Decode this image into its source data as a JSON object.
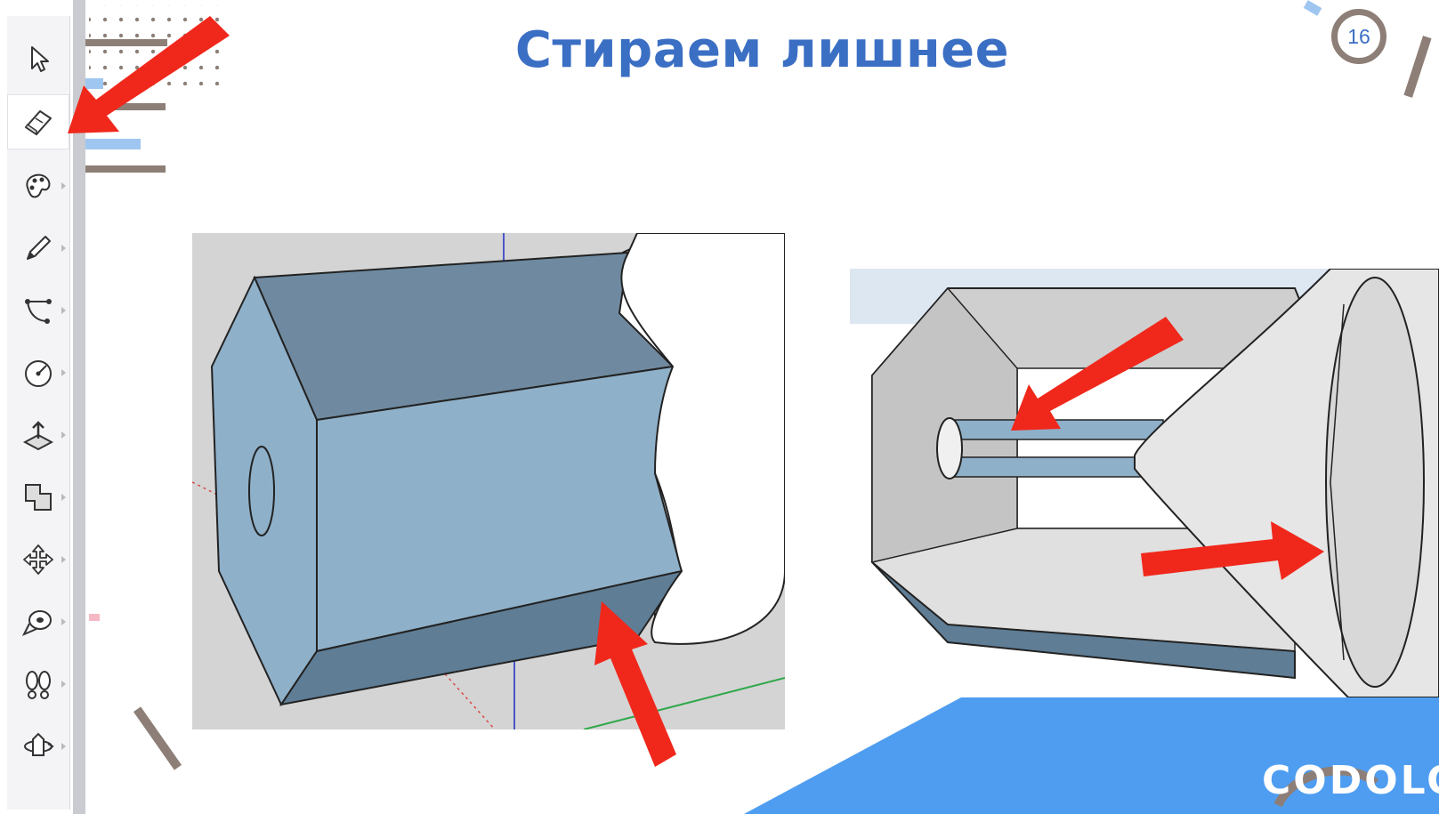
{
  "slide": {
    "title": "Стираем лишнее",
    "page_number": "16",
    "brand": "CODOLOGIA"
  },
  "toolbar": {
    "tools": [
      {
        "name": "select-tool",
        "icon": "arrow-cursor-icon",
        "active": false
      },
      {
        "name": "eraser-tool",
        "icon": "eraser-icon",
        "active": true
      },
      {
        "name": "paint-bucket-tool",
        "icon": "paint-palette-icon",
        "active": false
      },
      {
        "name": "line-tool",
        "icon": "pencil-icon",
        "active": false
      },
      {
        "name": "arc-tool",
        "icon": "arc-icon",
        "active": false
      },
      {
        "name": "circle-tool",
        "icon": "circle-icon",
        "active": false
      },
      {
        "name": "push-pull-tool",
        "icon": "push-pull-icon",
        "active": false
      },
      {
        "name": "offset-tool",
        "icon": "offset-icon",
        "active": false
      },
      {
        "name": "move-tool",
        "icon": "move-icon",
        "active": false
      },
      {
        "name": "tape-measure-tool",
        "icon": "tape-measure-icon",
        "active": false
      },
      {
        "name": "walk-tool",
        "icon": "footprints-icon",
        "active": false
      },
      {
        "name": "orbit-tool",
        "icon": "orbit-icon",
        "active": false
      }
    ]
  },
  "colors": {
    "title": "#3b6fc4",
    "arrow": "#f0281c",
    "model_face": "#8fb0c9",
    "model_dark": "#5f7d95",
    "brand_panel": "#4f9df0",
    "decor_taupe": "#8d7f77"
  }
}
